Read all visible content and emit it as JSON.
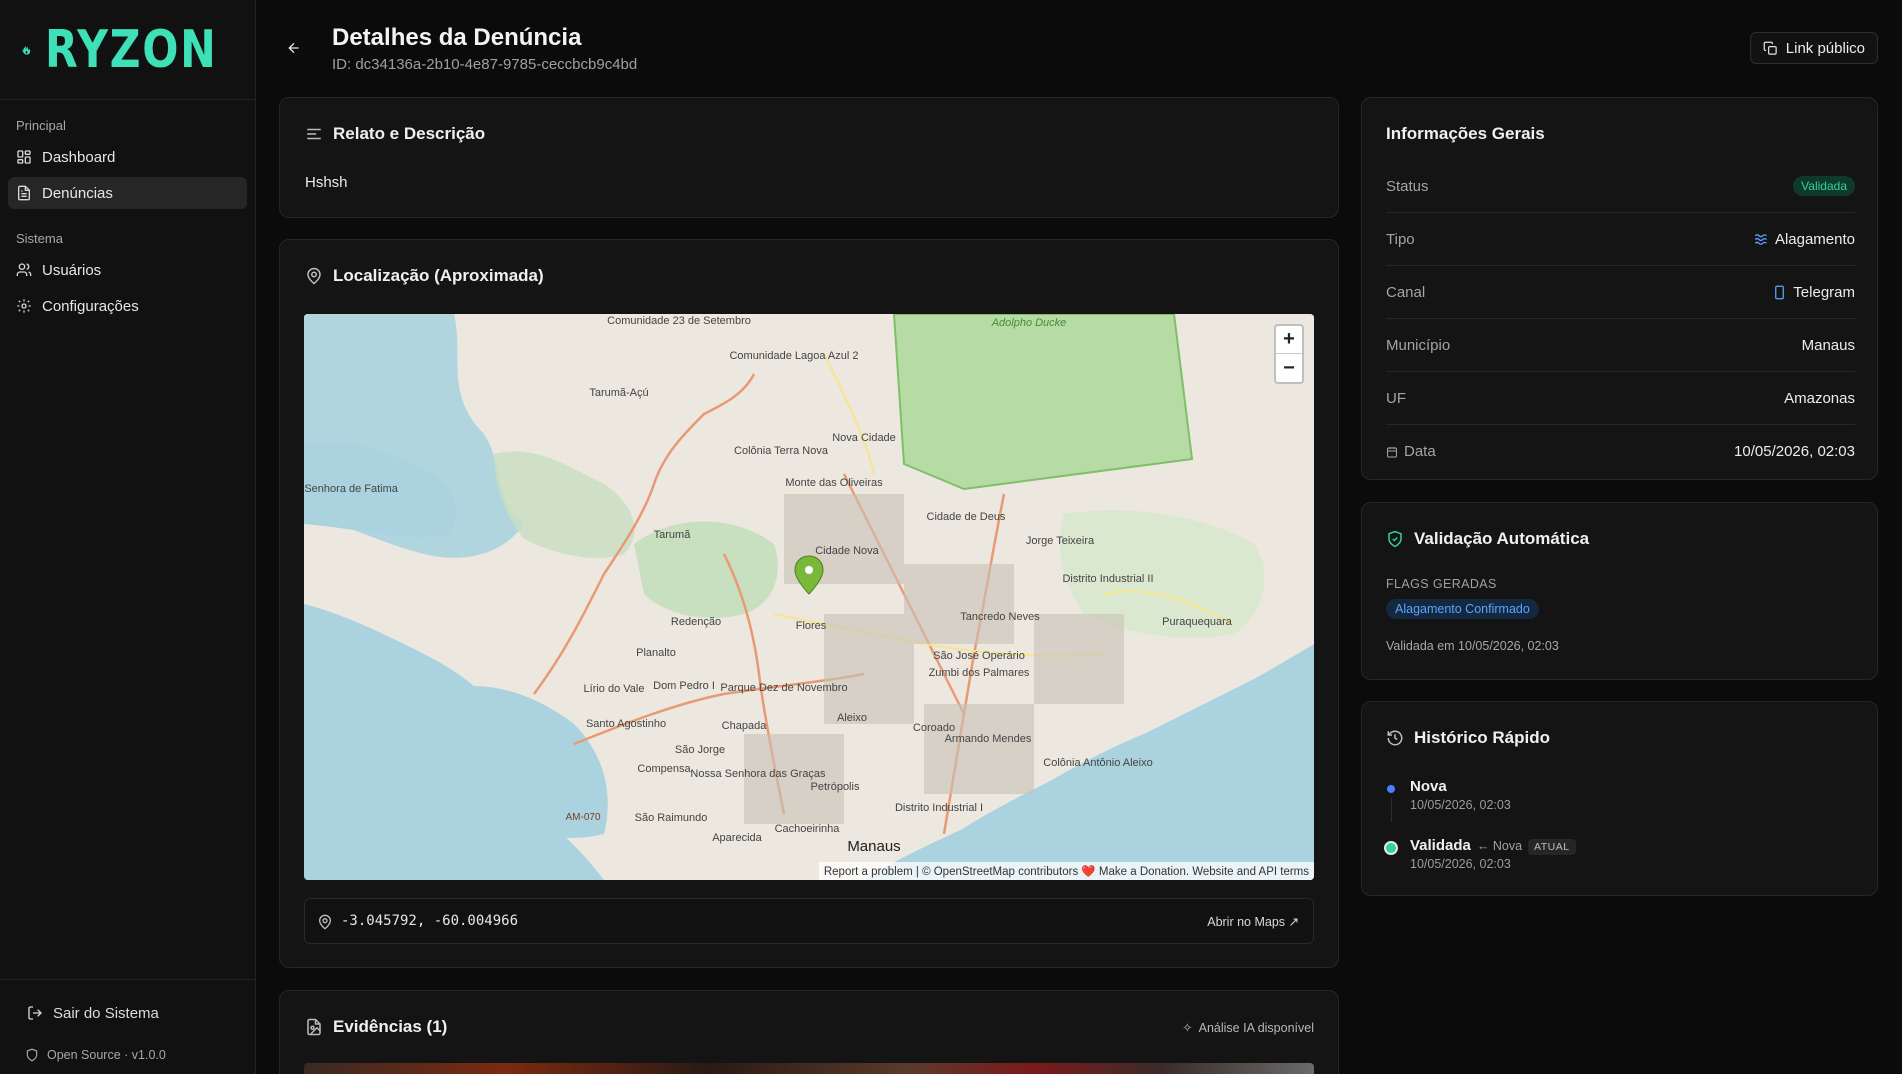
{
  "brand": {
    "name": "RYZON",
    "accent": "#3ee0b8"
  },
  "sidebar": {
    "sections": [
      {
        "heading": "Principal",
        "items": [
          {
            "label": "Dashboard",
            "icon": "grid-icon"
          },
          {
            "label": "Denúncias",
            "icon": "file-text-icon",
            "active": true
          }
        ]
      },
      {
        "heading": "Sistema",
        "items": [
          {
            "label": "Usuários",
            "icon": "users-icon"
          },
          {
            "label": "Configurações",
            "icon": "gear-icon"
          }
        ]
      }
    ],
    "logout_label": "Sair do Sistema",
    "version_label": "Open Source · v1.0.0"
  },
  "header": {
    "title": "Detalhes da Denúncia",
    "id_label": "ID: dc34136a-2b10-4e87-9785-ceccbcb9c4bd",
    "public_link_label": "Link público"
  },
  "relato": {
    "title": "Relato e Descrição",
    "text": "Hshsh"
  },
  "location": {
    "title": "Localização (Aproximada)",
    "coordinates": "-3.045792, -60.004966",
    "open_maps_label": "Abrir no Maps ↗",
    "zoom_in": "+",
    "zoom_out": "−",
    "attribution": "Report a problem | © OpenStreetMap contributors ❤️ Make a Donation. Website and API terms",
    "map_labels": [
      "Comunidade 23 de Setembro",
      "Comunidade Lagoa Azul 2",
      "Adolpho Ducke",
      "Tarumã-Açú",
      "Nova Cidade",
      "Colônia Terra Nova",
      "Monte das Oliveiras",
      "Nossa Senhora de Fatima",
      "Tarumã",
      "Cidade de Deus",
      "Jorge Teixeira",
      "Cidade Nova",
      "Distrito Industrial II",
      "Redenção",
      "Flores",
      "Tancredo Neves",
      "Puraquequara",
      "Planalto",
      "São José Operário",
      "Zumbi dos Palmares",
      "Lírio do Vale",
      "Dom Pedro I",
      "Parque Dez de Novembro",
      "Santo Agostinho",
      "Chapada",
      "Aleixo",
      "Coroado",
      "Armando Mendes",
      "São Jorge",
      "Compensa",
      "Nossa Senhora das Graças",
      "Colônia Antônio Aleixo",
      "Petrópolis",
      "AM-070",
      "São Raimundo",
      "Distrito Industrial I",
      "Aparecida",
      "Cachoeirinha",
      "Manaus"
    ]
  },
  "evidence": {
    "title": "Evidências (1)",
    "ai_label": "Análise IA disponível"
  },
  "info": {
    "title": "Informações Gerais",
    "rows": [
      {
        "label": "Status",
        "value": "Validada",
        "type": "badge"
      },
      {
        "label": "Tipo",
        "value": "Alagamento",
        "icon": "waves-icon"
      },
      {
        "label": "Canal",
        "value": "Telegram",
        "icon": "phone-icon"
      },
      {
        "label": "Município",
        "value": "Manaus"
      },
      {
        "label": "UF",
        "value": "Amazonas"
      },
      {
        "label": "Data",
        "value": "10/05/2026, 02:03",
        "label_icon": "calendar-icon"
      }
    ],
    "colors": {
      "status": "#33d19c",
      "type_icon": "#5aa4ff",
      "channel_icon": "#5aa4ff"
    }
  },
  "validation": {
    "title": "Validação Automática",
    "flags_label": "FLAGS GERADAS",
    "flag": "Alagamento Confirmado",
    "validated_at": "Validada em 10/05/2026, 02:03"
  },
  "history": {
    "title": "Histórico Rápido",
    "items": [
      {
        "name": "Nova",
        "time": "10/05/2026, 02:03",
        "from": "",
        "current": ""
      },
      {
        "name": "Validada",
        "time": "10/05/2026, 02:03",
        "from": "← Nova",
        "current": "ATUAL"
      }
    ]
  }
}
